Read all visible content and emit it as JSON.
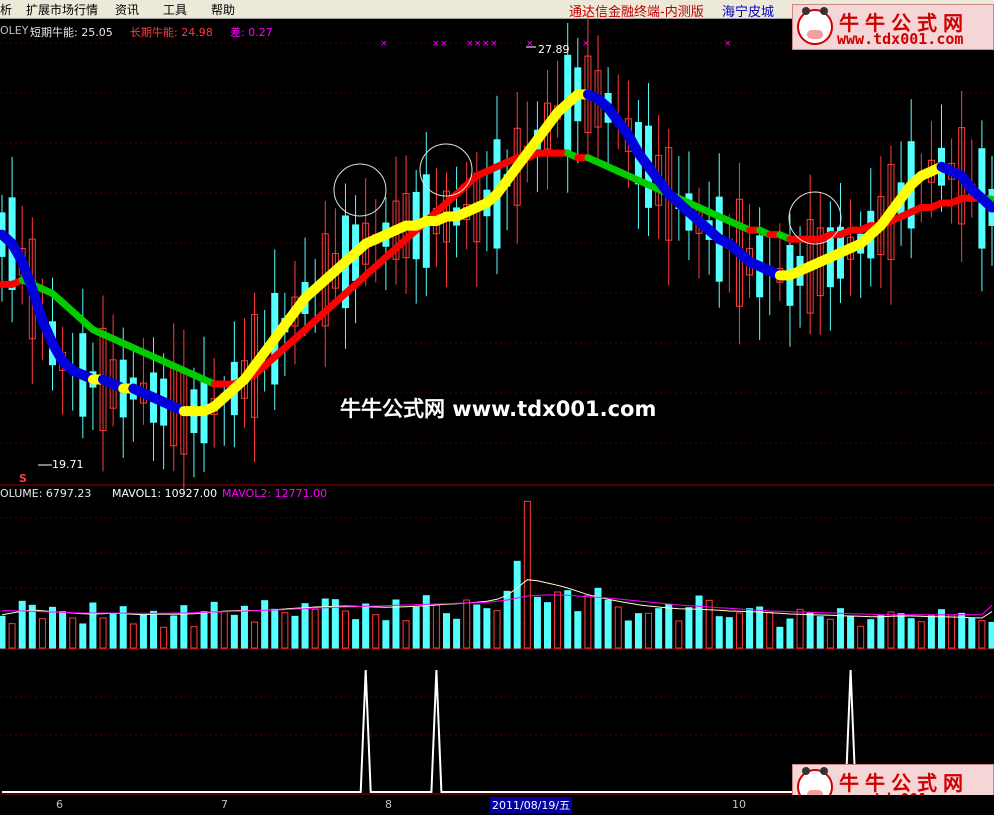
{
  "menu": {
    "items": [
      "析",
      "扩展市场行情",
      "资讯",
      "工具",
      "帮助"
    ],
    "app_title": "通达信金融终端-内测版",
    "shop_link": "海宁皮城"
  },
  "logo": {
    "title": "牛牛公式网",
    "url": "www.tdx001.com"
  },
  "watermark": "牛牛公式网 www.tdx001.com",
  "main_panel": {
    "label_name": "OLEY",
    "short_label": "短期牛能: 25.05",
    "long_label": "长期牛能: 24.98",
    "diff_label": "差: 0.27",
    "high_label": "27.89",
    "low_label": "19.71",
    "s_marker": "S"
  },
  "volume_panel": {
    "volume_label": "OLUME: 6797.23",
    "mavol1_label": "MAVOL1: 10927.00",
    "mavol2_label": "MAVOL2: 12771.00"
  },
  "time_axis": {
    "labels": [
      "6",
      "7",
      "8",
      "10"
    ],
    "date_label": "2011/08/19/五"
  },
  "colors": {
    "up_candle": "#ff3c3c",
    "down_candle": "#54ffff",
    "short_line_rising": "#ffff00",
    "short_line_falling": "#0000dd",
    "long_line_rising": "#ff0000",
    "long_line_falling": "#00cc00",
    "mavol1": "#ffffcc",
    "mavol2": "#ff00ff",
    "signal_line": "#ffffff"
  },
  "chart_data": [
    {
      "type": "line",
      "name": "price",
      "ylim": [
        19.0,
        28.5
      ],
      "low_marker": 19.71,
      "high_marker": 27.89,
      "series": [
        {
          "name": "短期牛能",
          "values": [
            24.2,
            24.0,
            23.6,
            23.0,
            22.3,
            21.8,
            21.4,
            21.2,
            21.1,
            21.0,
            21.0,
            20.9,
            20.8,
            20.8,
            20.7,
            20.6,
            20.5,
            20.4,
            20.3,
            20.3,
            20.3,
            20.4,
            20.6,
            20.8,
            21.0,
            21.3,
            21.6,
            21.9,
            22.2,
            22.5,
            22.8,
            23.0,
            23.2,
            23.4,
            23.6,
            23.8,
            24.0,
            24.1,
            24.2,
            24.3,
            24.4,
            24.4,
            24.5,
            24.5,
            24.6,
            24.6,
            24.7,
            24.8,
            24.9,
            25.1,
            25.4,
            25.7,
            26.0,
            26.3,
            26.6,
            26.9,
            27.1,
            27.3,
            27.3,
            27.2,
            27.0,
            26.7,
            26.4,
            26.0,
            25.7,
            25.4,
            25.1,
            24.9,
            24.7,
            24.5,
            24.3,
            24.1,
            24.0,
            23.8,
            23.6,
            23.5,
            23.4,
            23.3,
            23.3,
            23.4,
            23.5,
            23.6,
            23.7,
            23.8,
            23.9,
            24.0,
            24.2,
            24.4,
            24.7,
            25.0,
            25.3,
            25.5,
            25.6,
            25.7,
            25.6,
            25.5,
            25.2,
            25.0,
            24.8
          ]
        },
        {
          "name": "长期牛能",
          "values": [
            23.1,
            23.1,
            23.2,
            23.1,
            23.0,
            22.9,
            22.7,
            22.5,
            22.3,
            22.1,
            22.0,
            21.9,
            21.8,
            21.7,
            21.6,
            21.5,
            21.4,
            21.3,
            21.2,
            21.1,
            21.0,
            20.9,
            20.9,
            20.9,
            21.0,
            21.1,
            21.3,
            21.5,
            21.7,
            21.9,
            22.1,
            22.3,
            22.5,
            22.7,
            22.9,
            23.1,
            23.3,
            23.5,
            23.7,
            23.9,
            24.1,
            24.3,
            24.5,
            24.7,
            24.9,
            25.1,
            25.3,
            25.5,
            25.6,
            25.7,
            25.8,
            25.9,
            25.9,
            26.0,
            26.0,
            26.0,
            26.0,
            25.9,
            25.9,
            25.8,
            25.7,
            25.6,
            25.5,
            25.4,
            25.3,
            25.2,
            25.1,
            25.0,
            24.9,
            24.8,
            24.7,
            24.6,
            24.5,
            24.4,
            24.3,
            24.3,
            24.2,
            24.2,
            24.1,
            24.1,
            24.1,
            24.1,
            24.2,
            24.2,
            24.3,
            24.3,
            24.4,
            24.4,
            24.5,
            24.6,
            24.7,
            24.8,
            24.8,
            24.9,
            24.9,
            25.0,
            25.0,
            25.0,
            24.98
          ]
        }
      ]
    },
    {
      "type": "bar",
      "name": "volume",
      "ylim": [
        0,
        45000
      ],
      "values": [
        9500,
        7300,
        14000,
        12800,
        8800,
        12200,
        10900,
        9000,
        7200,
        13500,
        9000,
        10400,
        12400,
        7200,
        10000,
        11000,
        6200,
        9600,
        12700,
        6400,
        10900,
        13700,
        11000,
        9800,
        12500,
        7800,
        14200,
        11600,
        10600,
        9500,
        13300,
        11600,
        14700,
        14500,
        11100,
        8500,
        13200,
        10000,
        8200,
        14400,
        8200,
        12200,
        15700,
        13000,
        10300,
        8600,
        14400,
        12900,
        11800,
        11200,
        17000,
        26000,
        44000,
        15200,
        13600,
        16800,
        17200,
        10900,
        15800,
        17900,
        14300,
        12300,
        8100,
        10300,
        10400,
        11800,
        13100,
        8100,
        12100,
        15600,
        14300,
        9400,
        9100,
        10500,
        11800,
        12300,
        10700,
        6200,
        8700,
        11600,
        10600,
        9400,
        8600,
        11800,
        9500,
        6500,
        8500,
        9700,
        10800,
        10300,
        8800,
        7900,
        9600,
        11500,
        9900,
        10400,
        8900,
        8200,
        7700
      ],
      "series": [
        {
          "name": "MAVOL1",
          "values": [
            10000,
            10500,
            11000,
            11400,
            11200,
            10900,
            10700,
            10500,
            10300,
            10200,
            10300,
            10400,
            10300,
            10100,
            10000,
            10100,
            10200,
            10100,
            10200,
            10300,
            10500,
            10700,
            11000,
            11200,
            11300,
            11200,
            11300,
            11500,
            11700,
            11900,
            12100,
            12300,
            12400,
            12500,
            12600,
            12500,
            12400,
            12300,
            12200,
            12300,
            12400,
            12500,
            12700,
            12900,
            13100,
            13300,
            13500,
            13700,
            14000,
            14600,
            15800,
            18000,
            20500,
            20200,
            19500,
            18800,
            18000,
            17000,
            16000,
            15300,
            14600,
            14000,
            13500,
            13000,
            12600,
            12300,
            12000,
            11800,
            11700,
            11600,
            11500,
            11300,
            11100,
            11000,
            10900,
            10800,
            10600,
            10400,
            10200,
            10100,
            10000,
            9900,
            9800,
            9700,
            9600,
            9500,
            9400,
            9400,
            9500,
            9600,
            9600,
            9500,
            9400,
            9400,
            9300,
            9200,
            9100,
            9000,
            10927
          ]
        },
        {
          "name": "MAVOL2",
          "values": [
            11200,
            11200,
            11100,
            11000,
            10900,
            10800,
            10700,
            10600,
            10500,
            10500,
            10500,
            10500,
            10400,
            10400,
            10400,
            10400,
            10400,
            10500,
            10500,
            10600,
            10700,
            10800,
            10900,
            11000,
            11100,
            11200,
            11300,
            11400,
            11500,
            11700,
            11800,
            12000,
            12100,
            12200,
            12300,
            12400,
            12500,
            12600,
            12700,
            12800,
            12900,
            13000,
            13100,
            13200,
            13300,
            13400,
            13500,
            13600,
            13700,
            14000,
            14400,
            15000,
            15600,
            15800,
            15900,
            15900,
            15800,
            15600,
            15400,
            15200,
            15000,
            14700,
            14400,
            14100,
            13800,
            13500,
            13200,
            12900,
            12700,
            12500,
            12300,
            12100,
            11900,
            11700,
            11500,
            11300,
            11100,
            11000,
            10900,
            10800,
            10700,
            10600,
            10500,
            10400,
            10300,
            10200,
            10100,
            10000,
            10000,
            10000,
            10000,
            10000,
            10000,
            10000,
            10000,
            10000,
            10000,
            10000,
            12771
          ]
        }
      ]
    },
    {
      "type": "line",
      "name": "signal",
      "ylim": [
        0,
        1
      ],
      "series": [
        {
          "name": "signal",
          "values": [
            0,
            0,
            0,
            0,
            0,
            0,
            0,
            0,
            0,
            0,
            0,
            0,
            0,
            0,
            0,
            0,
            0,
            0,
            0,
            0,
            0,
            0,
            0,
            0,
            0,
            0,
            0,
            0,
            0,
            0,
            0,
            0,
            0,
            0,
            0,
            0,
            1,
            0,
            0,
            0,
            0,
            0,
            0,
            1,
            0,
            0,
            0,
            0,
            0,
            0,
            0,
            0,
            0,
            0,
            0,
            0,
            0,
            0,
            0,
            0,
            0,
            0,
            0,
            0,
            0,
            0,
            0,
            0,
            0,
            0,
            0,
            0,
            0,
            0,
            0,
            0,
            0,
            0,
            0,
            0,
            0,
            0,
            0,
            0,
            1,
            0,
            0,
            0,
            0,
            0,
            0,
            0,
            0,
            0,
            0,
            0,
            0,
            0,
            0
          ]
        }
      ]
    }
  ]
}
